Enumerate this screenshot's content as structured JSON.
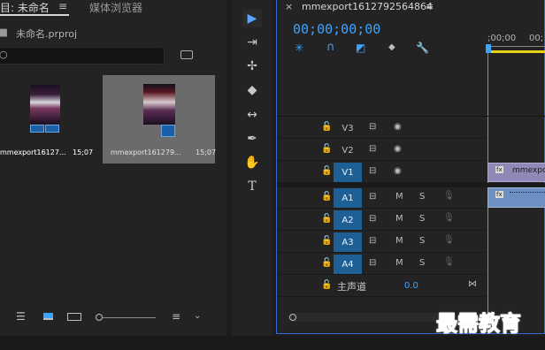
{
  "project_panel": {
    "tab_project_label": "目: 未命名",
    "tab_menu_icon": "hamburger-icon",
    "tab_media_browser_label": "媒体浏览器",
    "project_file_label": "未命名.prproj",
    "clips": [
      {
        "name": "mmexport16127...",
        "duration": "15;07",
        "selected": false
      },
      {
        "name": "mmexport161279...",
        "duration": "15;07",
        "selected": true
      }
    ],
    "bottom_icons": [
      "list-view-icon",
      "icon-view-icon",
      "freeform-view-icon",
      "zoom-slider",
      "sort-icon",
      "chevron-down-icon"
    ]
  },
  "tools": [
    "selection-tool",
    "track-select-tool",
    "ripple-edit-tool",
    "razor-tool",
    "slip-tool",
    "pen-tool",
    "hand-tool",
    "type-tool"
  ],
  "timeline": {
    "sequence_name": "mmexport1612792564864",
    "timecode": "00;00;00;00",
    "ruler_labels": [
      ";00;00",
      "00;"
    ],
    "tracks": [
      {
        "id": "V3",
        "type": "video",
        "targeted": false
      },
      {
        "id": "V2",
        "type": "video",
        "targeted": false
      },
      {
        "id": "V1",
        "type": "video",
        "targeted": true
      },
      {
        "id": "A1",
        "type": "audio",
        "targeted": true
      },
      {
        "id": "A2",
        "type": "audio",
        "targeted": true
      },
      {
        "id": "A3",
        "type": "audio",
        "targeted": true
      },
      {
        "id": "A4",
        "type": "audio",
        "targeted": true
      }
    ],
    "video_clip_label": "mmexport",
    "master_label": "主声道",
    "master_value": "0.0",
    "mute_label": "M",
    "solo_label": "S"
  },
  "watermark": "最需教育",
  "colors": {
    "accent_blue": "#3ea3ff",
    "target_blue": "#1e5f96",
    "timeline_border": "#2f6bcf"
  }
}
